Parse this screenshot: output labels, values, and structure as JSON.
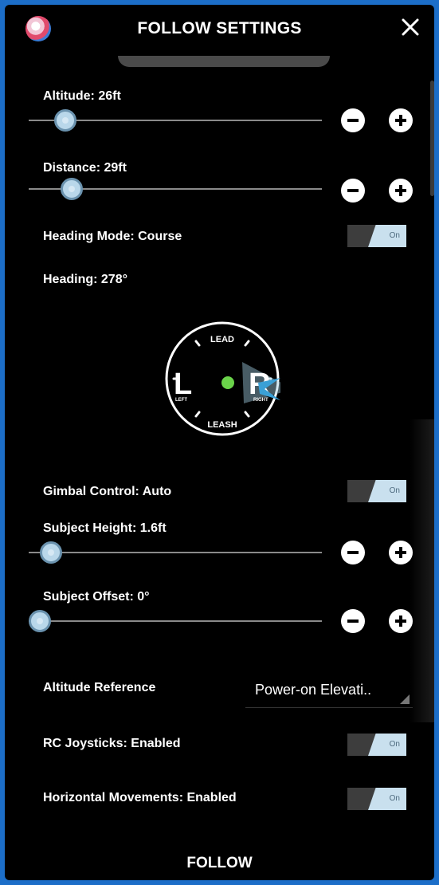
{
  "header": {
    "title": "FOLLOW SETTINGS"
  },
  "controls": {
    "altitude": {
      "label": "Altitude: 26ft"
    },
    "distance": {
      "label": "Distance: 29ft"
    },
    "heading_mode": {
      "label": "Heading Mode: Course",
      "toggle_text": "On"
    },
    "heading": {
      "label": "Heading: 278°"
    },
    "gimbal_control": {
      "label": "Gimbal Control: Auto",
      "toggle_text": "On"
    },
    "subject_height": {
      "label": "Subject Height: 1.6ft"
    },
    "subject_offset": {
      "label": "Subject Offset: 0°"
    },
    "altitude_reference": {
      "label": "Altitude Reference",
      "value": "Power-on Elevati.."
    },
    "rc_joysticks": {
      "label": "RC Joysticks: Enabled",
      "toggle_text": "On"
    },
    "horizontal_movements": {
      "label": "Horizontal Movements: Enabled",
      "toggle_text": "On"
    }
  },
  "dial": {
    "top": "LEAD",
    "bottom": "LEASH",
    "left_letter": "L",
    "left_small": "LEFT",
    "right_letter": "R",
    "right_small": "RIGHT"
  },
  "footer": {
    "label": "FOLLOW"
  },
  "icons": {
    "logo": "app-logo-icon",
    "close": "close-icon",
    "minus": "minus-icon",
    "plus": "plus-icon"
  },
  "colors": {
    "accent": "#c9e0ee",
    "frame": "#1c6ec8",
    "dot": "#6ad34a"
  }
}
